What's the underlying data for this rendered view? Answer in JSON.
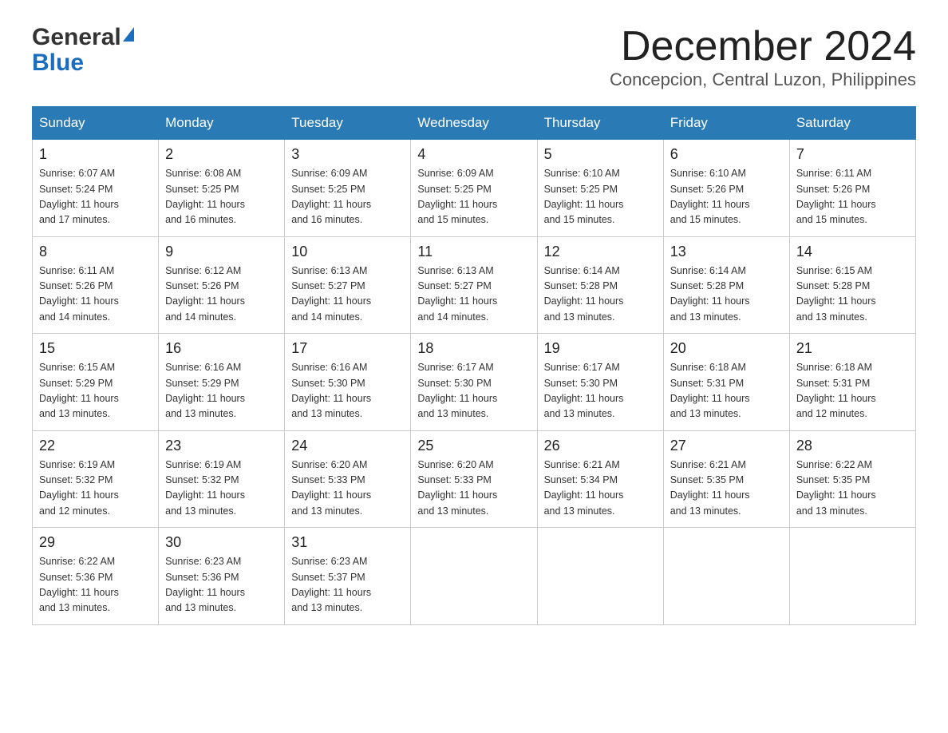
{
  "header": {
    "logo_general": "General",
    "logo_blue": "Blue",
    "month_title": "December 2024",
    "location": "Concepcion, Central Luzon, Philippines"
  },
  "days_of_week": [
    "Sunday",
    "Monday",
    "Tuesday",
    "Wednesday",
    "Thursday",
    "Friday",
    "Saturday"
  ],
  "weeks": [
    [
      {
        "day": "1",
        "sunrise": "6:07 AM",
        "sunset": "5:24 PM",
        "daylight": "11 hours and 17 minutes."
      },
      {
        "day": "2",
        "sunrise": "6:08 AM",
        "sunset": "5:25 PM",
        "daylight": "11 hours and 16 minutes."
      },
      {
        "day": "3",
        "sunrise": "6:09 AM",
        "sunset": "5:25 PM",
        "daylight": "11 hours and 16 minutes."
      },
      {
        "day": "4",
        "sunrise": "6:09 AM",
        "sunset": "5:25 PM",
        "daylight": "11 hours and 15 minutes."
      },
      {
        "day": "5",
        "sunrise": "6:10 AM",
        "sunset": "5:25 PM",
        "daylight": "11 hours and 15 minutes."
      },
      {
        "day": "6",
        "sunrise": "6:10 AM",
        "sunset": "5:26 PM",
        "daylight": "11 hours and 15 minutes."
      },
      {
        "day": "7",
        "sunrise": "6:11 AM",
        "sunset": "5:26 PM",
        "daylight": "11 hours and 15 minutes."
      }
    ],
    [
      {
        "day": "8",
        "sunrise": "6:11 AM",
        "sunset": "5:26 PM",
        "daylight": "11 hours and 14 minutes."
      },
      {
        "day": "9",
        "sunrise": "6:12 AM",
        "sunset": "5:26 PM",
        "daylight": "11 hours and 14 minutes."
      },
      {
        "day": "10",
        "sunrise": "6:13 AM",
        "sunset": "5:27 PM",
        "daylight": "11 hours and 14 minutes."
      },
      {
        "day": "11",
        "sunrise": "6:13 AM",
        "sunset": "5:27 PM",
        "daylight": "11 hours and 14 minutes."
      },
      {
        "day": "12",
        "sunrise": "6:14 AM",
        "sunset": "5:28 PM",
        "daylight": "11 hours and 13 minutes."
      },
      {
        "day": "13",
        "sunrise": "6:14 AM",
        "sunset": "5:28 PM",
        "daylight": "11 hours and 13 minutes."
      },
      {
        "day": "14",
        "sunrise": "6:15 AM",
        "sunset": "5:28 PM",
        "daylight": "11 hours and 13 minutes."
      }
    ],
    [
      {
        "day": "15",
        "sunrise": "6:15 AM",
        "sunset": "5:29 PM",
        "daylight": "11 hours and 13 minutes."
      },
      {
        "day": "16",
        "sunrise": "6:16 AM",
        "sunset": "5:29 PM",
        "daylight": "11 hours and 13 minutes."
      },
      {
        "day": "17",
        "sunrise": "6:16 AM",
        "sunset": "5:30 PM",
        "daylight": "11 hours and 13 minutes."
      },
      {
        "day": "18",
        "sunrise": "6:17 AM",
        "sunset": "5:30 PM",
        "daylight": "11 hours and 13 minutes."
      },
      {
        "day": "19",
        "sunrise": "6:17 AM",
        "sunset": "5:30 PM",
        "daylight": "11 hours and 13 minutes."
      },
      {
        "day": "20",
        "sunrise": "6:18 AM",
        "sunset": "5:31 PM",
        "daylight": "11 hours and 13 minutes."
      },
      {
        "day": "21",
        "sunrise": "6:18 AM",
        "sunset": "5:31 PM",
        "daylight": "11 hours and 12 minutes."
      }
    ],
    [
      {
        "day": "22",
        "sunrise": "6:19 AM",
        "sunset": "5:32 PM",
        "daylight": "11 hours and 12 minutes."
      },
      {
        "day": "23",
        "sunrise": "6:19 AM",
        "sunset": "5:32 PM",
        "daylight": "11 hours and 13 minutes."
      },
      {
        "day": "24",
        "sunrise": "6:20 AM",
        "sunset": "5:33 PM",
        "daylight": "11 hours and 13 minutes."
      },
      {
        "day": "25",
        "sunrise": "6:20 AM",
        "sunset": "5:33 PM",
        "daylight": "11 hours and 13 minutes."
      },
      {
        "day": "26",
        "sunrise": "6:21 AM",
        "sunset": "5:34 PM",
        "daylight": "11 hours and 13 minutes."
      },
      {
        "day": "27",
        "sunrise": "6:21 AM",
        "sunset": "5:35 PM",
        "daylight": "11 hours and 13 minutes."
      },
      {
        "day": "28",
        "sunrise": "6:22 AM",
        "sunset": "5:35 PM",
        "daylight": "11 hours and 13 minutes."
      }
    ],
    [
      {
        "day": "29",
        "sunrise": "6:22 AM",
        "sunset": "5:36 PM",
        "daylight": "11 hours and 13 minutes."
      },
      {
        "day": "30",
        "sunrise": "6:23 AM",
        "sunset": "5:36 PM",
        "daylight": "11 hours and 13 minutes."
      },
      {
        "day": "31",
        "sunrise": "6:23 AM",
        "sunset": "5:37 PM",
        "daylight": "11 hours and 13 minutes."
      },
      {
        "day": "",
        "sunrise": "",
        "sunset": "",
        "daylight": ""
      },
      {
        "day": "",
        "sunrise": "",
        "sunset": "",
        "daylight": ""
      },
      {
        "day": "",
        "sunrise": "",
        "sunset": "",
        "daylight": ""
      },
      {
        "day": "",
        "sunrise": "",
        "sunset": "",
        "daylight": ""
      }
    ]
  ],
  "labels": {
    "sunrise_prefix": "Sunrise: ",
    "sunset_prefix": "Sunset: ",
    "daylight_prefix": "Daylight: "
  }
}
